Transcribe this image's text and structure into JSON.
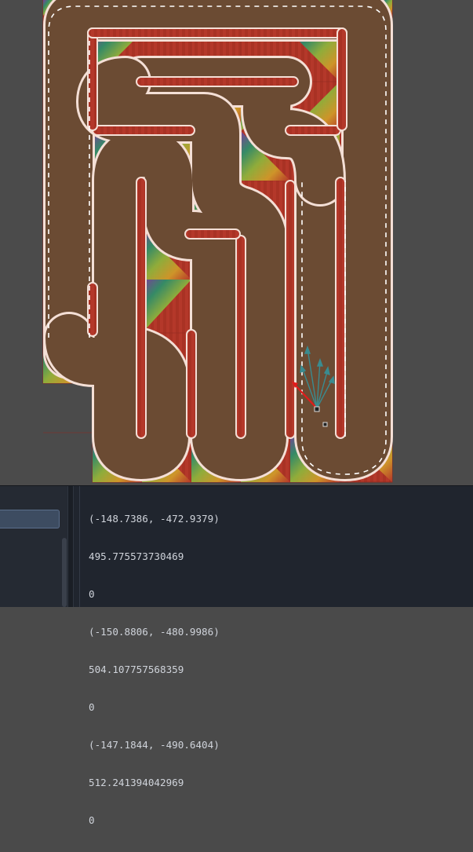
{
  "scene": {
    "track_color": "#6b4b33",
    "curb_color": "#b4382a",
    "line_color": "#f3d9cf",
    "background_color": "#4b4b4b",
    "car_icon": "car-marker-icon",
    "gizmo_icon": "ray-fan-icon"
  },
  "output_panel": {
    "lines": [
      "(-148.7386, -472.9379)",
      "495.775573730469",
      "0",
      "(-150.8806, -480.9986)",
      "504.107757568359",
      "0",
      "(-147.1844, -490.6404)",
      "512.241394042969",
      "0"
    ]
  }
}
